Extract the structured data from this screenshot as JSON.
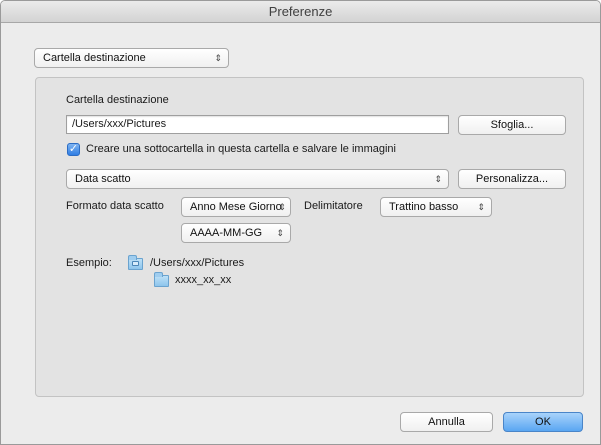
{
  "window": {
    "title": "Preferenze"
  },
  "top_popup": {
    "value": "Cartella destinazione"
  },
  "group": {
    "section_label": "Cartella destinazione",
    "path_value": "/Users/xxx/Pictures",
    "browse_label": "Sfoglia...",
    "subfolder_checkbox": {
      "label": "Creare una sottocartella in questa cartella e salvare le immagini",
      "checked": true
    },
    "subfolder_type": {
      "value": "Data scatto"
    },
    "customize_label": "Personalizza...",
    "date_format_label": "Formato data scatto",
    "date_order": {
      "value": "Anno Mese Giorno"
    },
    "delimiter_label": "Delimitatore",
    "delimiter": {
      "value": "Trattino basso"
    },
    "date_pattern": {
      "value": "AAAA-MM-GG"
    },
    "example_label": "Esempio:",
    "example_path": "/Users/xxx/Pictures",
    "example_subfolder": "xxxx_xx_xx"
  },
  "footer": {
    "cancel_label": "Annulla",
    "ok_label": "OK"
  },
  "icons": {
    "popup_arrows": "⇕",
    "checkmark": "✓"
  },
  "colors": {
    "accent": "#5aa6f2",
    "window_bg": "#ececec",
    "group_bg": "#e3e3e3"
  }
}
